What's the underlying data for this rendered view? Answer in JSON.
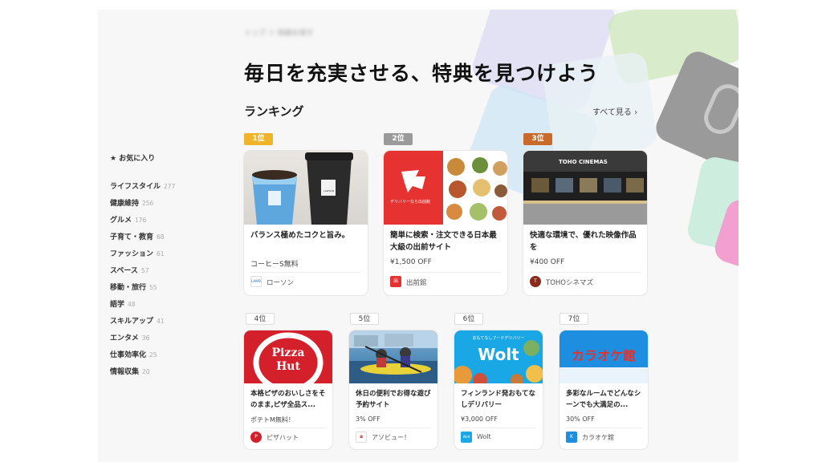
{
  "breadcrumb": "トップ ＞ 特典を探す",
  "headline": "毎日を充実させる、特典を見つけよう",
  "ranking_title": "ランキング",
  "see_all": "すべて見る ›",
  "sidebar": {
    "favorites": "★ お気に入り",
    "categories": [
      {
        "label": "ライフスタイル",
        "count": "277"
      },
      {
        "label": "健康維持",
        "count": "256"
      },
      {
        "label": "グルメ",
        "count": "176"
      },
      {
        "label": "子育て・教育",
        "count": "68"
      },
      {
        "label": "ファッション",
        "count": "61"
      },
      {
        "label": "スペース",
        "count": "57"
      },
      {
        "label": "移動・旅行",
        "count": "55"
      },
      {
        "label": "語学",
        "count": "48"
      },
      {
        "label": "スキルアップ",
        "count": "41"
      },
      {
        "label": "エンタメ",
        "count": "36"
      },
      {
        "label": "仕事効率化",
        "count": "25"
      },
      {
        "label": "情報収集",
        "count": "20"
      }
    ]
  },
  "cards": [
    {
      "rank": "1位",
      "title": "バランス極めたコクと旨み。",
      "offer": "コーヒーS無料",
      "merchant": "ローソン",
      "logo": "LAWSON"
    },
    {
      "rank": "2位",
      "title": "簡単に検索・注文できる日本最大級の出前サイト",
      "offer": "¥1,500 OFF",
      "merchant": "出前館",
      "logo": "出"
    },
    {
      "rank": "3位",
      "title": "快適な環境で、優れた映像作品を",
      "offer": "¥400 OFF",
      "merchant": "TOHOシネマズ",
      "logo": "T"
    },
    {
      "rank": "4位",
      "title": "本格ピザのおいしさをそのまま,ピザ全品ス...",
      "offer": "ポテトM無料！",
      "merchant": "ピザハット",
      "logo": "P"
    },
    {
      "rank": "5位",
      "title": "休日の便利でお得な遊び予約サイト",
      "offer": "3% OFF",
      "merchant": "アソビュー！",
      "logo": "a"
    },
    {
      "rank": "6位",
      "title": "フィンランド発おもてなしデリバリー",
      "offer": "¥3,000 OFF",
      "merchant": "Wolt",
      "logo": "Wolt"
    },
    {
      "rank": "7位",
      "title": "多彩なルームでどんなシーンでも大満足の...",
      "offer": "30% OFF",
      "merchant": "カラオケ館",
      "logo": "K"
    }
  ],
  "images": {
    "demaecan_text": "デリバリーなら出前館",
    "toho_sign": "TOHO CINEMAS",
    "pizza1": "Pizza",
    "pizza2": "Hut",
    "wolt_sub": "おもてなしフードデリバリー",
    "wolt_word": "Wolt",
    "karaoke": "カラオケ館",
    "lawson_cup": "LAWSON"
  },
  "colors": {
    "rank1": "#f0b42a",
    "rank2": "#9a9a9a",
    "rank3": "#c96a2a",
    "demaecan_red": "#e63332",
    "pizza_red": "#d4202b",
    "wolt_blue": "#1aa7e6",
    "karaoke_blue": "#1e8fe0",
    "karaoke_red": "#e3312d"
  }
}
